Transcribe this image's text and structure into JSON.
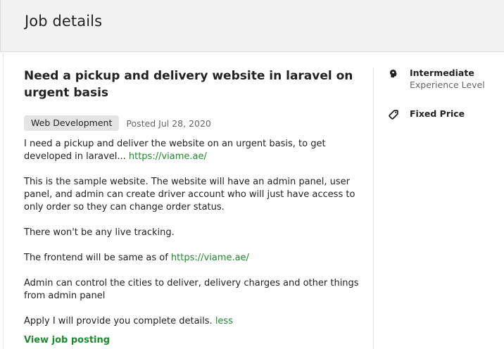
{
  "header": {
    "title": "Job details"
  },
  "job": {
    "title": "Need a pickup and delivery website in laravel on urgent basis",
    "category": "Web Development",
    "posted": "Posted Jul 28, 2020",
    "description": {
      "p1_text": "I need a pickup and deliver the website on an urgent basis, to get developed in laravel... ",
      "p1_link": "https://viame.ae/",
      "p2": "This is the sample website. The website will have an admin panel, user panel, and admin can create driver account who will just have access to only order so they can change order status.",
      "p3": "There won't be any live tracking.",
      "p4_text": "The frontend will be same as of ",
      "p4_link": "https://viame.ae/",
      "p5": "Admin can control the cities to deliver, delivery charges and other things from admin panel",
      "p6_text": "Apply I will provide you complete details. ",
      "p6_link": "less"
    },
    "view_link": "View job posting"
  },
  "sidebar": {
    "experience": {
      "label": "Intermediate",
      "sub": "Experience Level",
      "icon": "brain-icon"
    },
    "price": {
      "label": "Fixed Price",
      "icon": "price-tag-icon"
    }
  },
  "colors": {
    "link": "#1f8a2e",
    "tag_bg": "#e4e4e4",
    "header_bg": "#f2f2f2"
  }
}
